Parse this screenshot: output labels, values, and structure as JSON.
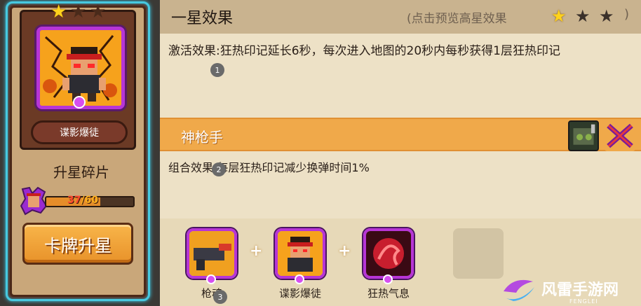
{
  "card": {
    "name": "谍影爆徒",
    "stars_lit": 1,
    "stars_total": 3,
    "fragments_title": "升星碎片",
    "progress": {
      "current": "37",
      "separator": "/",
      "max": "60",
      "fraction": 0.62
    },
    "upgrade_label": "卡牌升星",
    "colors": {
      "frame_glow": "#47c9e0",
      "portrait_border": "#b735d6",
      "button": "#f0a032"
    }
  },
  "effect": {
    "title": "一星效果",
    "preview_label": "(点击预览高星效果",
    "close_paren": ")",
    "preview_stars_lit": 1,
    "preview_stars_total": 3,
    "description": "激活效果:狂热印记延长6秒，每次进入地图的20秒内每秒获得1层狂热印记",
    "markers": [
      "1",
      "2",
      "3"
    ]
  },
  "combo": {
    "name": "神枪手",
    "effect": "组合效果:每层狂热印记减少换弹时间1%",
    "icons": [
      "gear-mech-icon",
      "crossed-guns-icon"
    ]
  },
  "skills": [
    {
      "label": "枪魂",
      "icon": "gun-soul-icon"
    },
    {
      "label": "谍影爆徒",
      "icon": "hero-portrait-icon"
    },
    {
      "label": "狂热气息",
      "icon": "fervor-aura-icon"
    }
  ],
  "watermark": {
    "text": "风雷手游网",
    "sub": "FENGLEI"
  }
}
